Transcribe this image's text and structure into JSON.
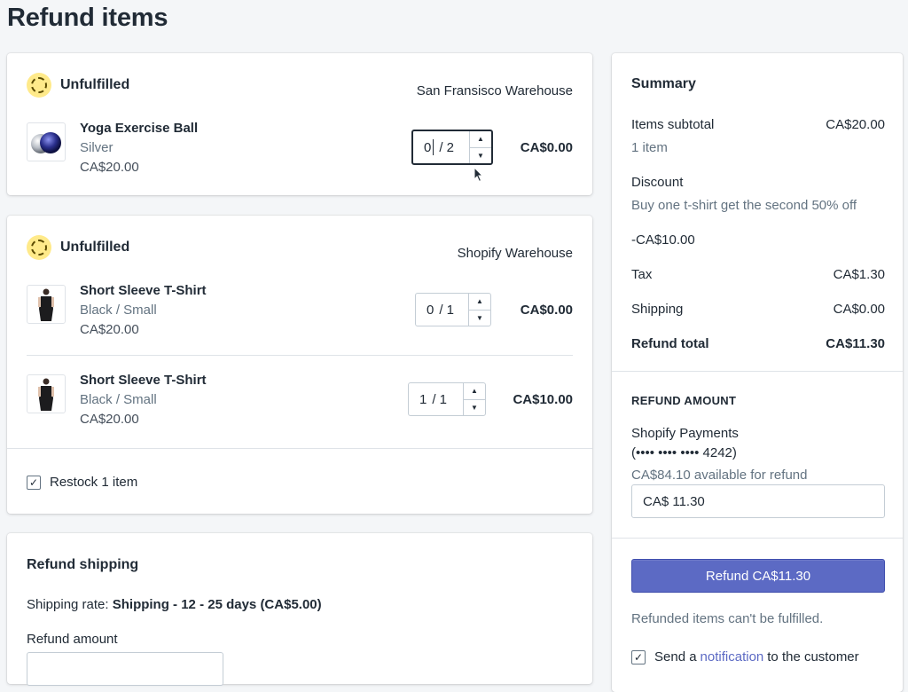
{
  "page": {
    "title": "Refund items"
  },
  "fulfillment_groups": [
    {
      "status": "Unfulfilled",
      "location": "San Fransisco Warehouse",
      "items": [
        {
          "name": "Yoga Exercise Ball",
          "variant": "Silver",
          "price": "CA$20.00",
          "qty": "0",
          "qty_total": "/ 2",
          "line_total": "CA$0.00",
          "thumb_icon": "ball-image"
        }
      ]
    },
    {
      "status": "Unfulfilled",
      "location": "Shopify Warehouse",
      "items": [
        {
          "name": "Short Sleeve T-Shirt",
          "variant": "Black / Small",
          "price": "CA$20.00",
          "qty": "0",
          "qty_total": "/ 1",
          "line_total": "CA$0.00",
          "thumb_icon": "tshirt-image"
        },
        {
          "name": "Short Sleeve T-Shirt",
          "variant": "Black / Small",
          "price": "CA$20.00",
          "qty": "1",
          "qty_total": "/ 1",
          "line_total": "CA$10.00",
          "thumb_icon": "tshirt-image"
        }
      ],
      "restock_label": "Restock 1 item",
      "restock_checked": true
    }
  ],
  "refund_shipping": {
    "heading": "Refund shipping",
    "rate_prefix": "Shipping rate: ",
    "rate_value": "Shipping - 12 - 25 days (CA$5.00)",
    "amount_label": "Refund amount"
  },
  "summary": {
    "heading": "Summary",
    "items_subtotal_label": "Items subtotal",
    "items_subtotal_value": "CA$20.00",
    "items_count": "1 item",
    "discount_label": "Discount",
    "discount_desc": "Buy one t-shirt get the second 50% off",
    "discount_value": "-CA$10.00",
    "tax_label": "Tax",
    "tax_value": "CA$1.30",
    "shipping_label": "Shipping",
    "shipping_value": "CA$0.00",
    "refund_total_label": "Refund total",
    "refund_total_value": "CA$11.30",
    "refund_amount_heading": "REFUND AMOUNT",
    "payment_method": "Shopify Payments",
    "card_mask": "(•••• •••• •••• 4242)",
    "available": "CA$84.10 available for refund",
    "amount_input_value": "CA$ 11.30",
    "refund_button": "Refund CA$11.30",
    "notice": "Refunded items can't be fulfilled.",
    "notify_prefix": "Send a ",
    "notify_link": "notification",
    "notify_suffix": " to the customer",
    "notify_checked": true
  },
  "colors": {
    "primary": "#5c6ac4",
    "status_unfulfilled": "#ffea8a",
    "background": "#f4f6f8"
  }
}
